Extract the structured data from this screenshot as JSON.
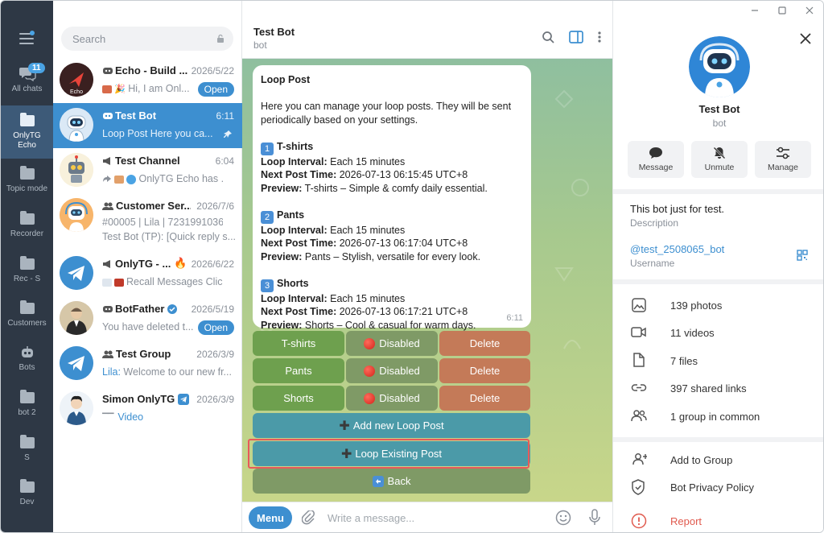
{
  "window": {
    "controls": [
      "minimize",
      "maximize",
      "close"
    ]
  },
  "rail": {
    "items": [
      {
        "label": "All chats",
        "badge": "11"
      },
      {
        "label": "OnlyTG Echo"
      },
      {
        "label": "Topic mode"
      },
      {
        "label": "Recorder"
      },
      {
        "label": "Rec - S"
      },
      {
        "label": "Customers"
      },
      {
        "label": "Bots"
      },
      {
        "label": "bot 2"
      },
      {
        "label": "S"
      },
      {
        "label": "Dev"
      }
    ]
  },
  "search": {
    "placeholder": "Search"
  },
  "chats": [
    {
      "name": "Echo - Build ...",
      "time": "2026/5/22",
      "message": "Hi, I am Onl...",
      "pill": "Open"
    },
    {
      "name": "Test Bot",
      "time": "6:11",
      "message": "Loop Post Here you ca..."
    },
    {
      "name": "Test Channel",
      "time": "6:04",
      "message": "OnlyTG Echo has ..."
    },
    {
      "name": "Customer Ser...",
      "time": "2026/7/6",
      "message": "#00005 | Lila | 7231991036",
      "message2": "Test Bot (TP): [Quick reply s..."
    },
    {
      "name": "OnlyTG - ...",
      "time": "2026/6/22",
      "message": "Recall Messages Clic..."
    },
    {
      "name": "BotFather",
      "time": "2026/5/19",
      "message": "You have deleted t...",
      "pill": "Open"
    },
    {
      "name": "Test Group",
      "time": "2026/3/9",
      "sender": "Lila:",
      "message": "Welcome to our new fr..."
    },
    {
      "name": "Simon OnlyTG",
      "time": "2026/3/9",
      "message": "Video"
    }
  ],
  "header": {
    "title": "Test Bot",
    "subtitle": "bot"
  },
  "message": {
    "title": "Loop Post",
    "intro": "Here you can manage your loop posts. They will be sent periodically based on your settings.",
    "posts": [
      {
        "num": "1",
        "name": "T-shirts",
        "interval_label": "Loop Interval:",
        "interval": "Each 15 minutes",
        "next_label": "Next Post Time:",
        "next": "2026-07-13 06:15:45 UTC+8",
        "preview_label": "Preview:",
        "preview": "T-shirts – Simple & comfy daily essential."
      },
      {
        "num": "2",
        "name": "Pants",
        "interval_label": "Loop Interval:",
        "interval": "Each 15 minutes",
        "next_label": "Next Post Time:",
        "next": "2026-07-13 06:17:04 UTC+8",
        "preview_label": "Preview:",
        "preview": "Pants – Stylish, versatile for every look."
      },
      {
        "num": "3",
        "name": "Shorts",
        "interval_label": "Loop Interval:",
        "interval": "Each 15 minutes",
        "next_label": "Next Post Time:",
        "next": "2026-07-13 06:17:21 UTC+8",
        "preview_label": "Preview:",
        "preview": "Shorts – Cool & casual for warm days."
      }
    ],
    "time": "6:11"
  },
  "keyboard": {
    "rows": [
      {
        "item": "T-shirts",
        "status": "Disabled",
        "delete": "Delete"
      },
      {
        "item": "Pants",
        "status": "Disabled",
        "delete": "Delete"
      },
      {
        "item": "Shorts",
        "status": "Disabled",
        "delete": "Delete"
      }
    ],
    "add": "Add new Loop Post",
    "loop_existing": "Loop Existing Post",
    "back": "Back"
  },
  "composer": {
    "menu": "Menu",
    "placeholder": "Write a message..."
  },
  "profile": {
    "name": "Test Bot",
    "subtitle": "bot",
    "actions": [
      "Message",
      "Unmute",
      "Manage"
    ],
    "bio": "This bot just for test.",
    "bio_label": "Description",
    "username": "@test_2508065_bot",
    "username_label": "Username",
    "media": [
      "139 photos",
      "11 videos",
      "7 files",
      "397 shared links",
      "1 group in common"
    ],
    "add_to_group": "Add to Group",
    "privacy": "Bot Privacy Policy",
    "report": "Report"
  },
  "colors": {
    "accent": "#3d8fd0",
    "rail": "#2e3845",
    "report": "#e05a4e",
    "highlight": "#e85a5a"
  }
}
